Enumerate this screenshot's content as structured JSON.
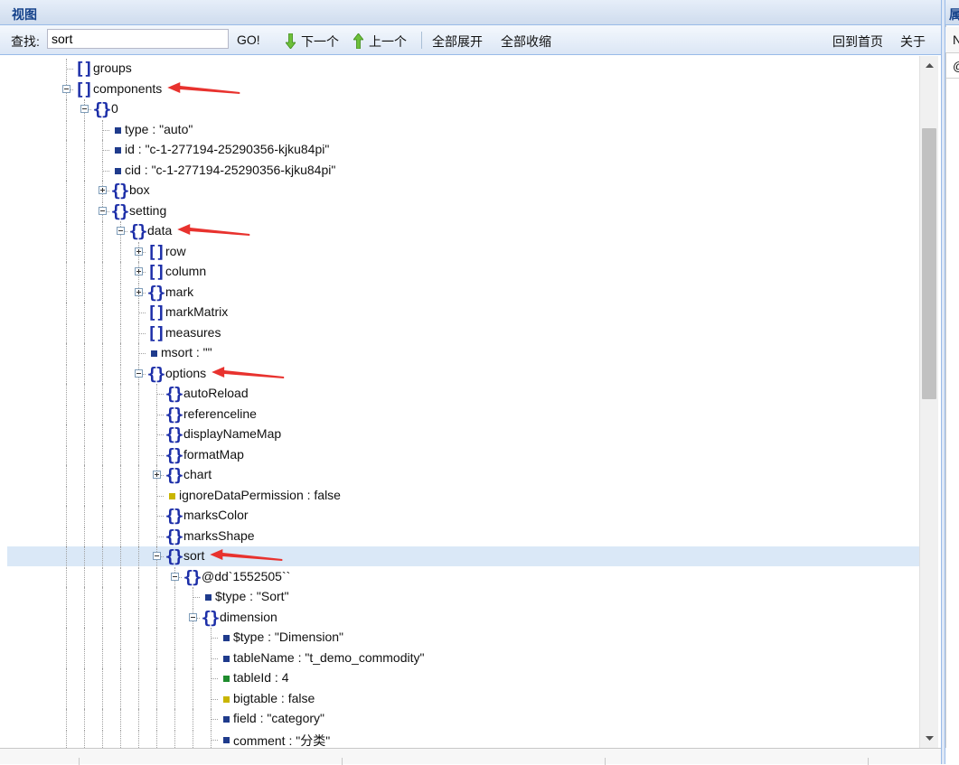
{
  "panel": {
    "title": "视图",
    "right_title": "属"
  },
  "right_panel": {
    "cell1": "N",
    "cell2": "@"
  },
  "toolbar": {
    "search_label": "查找:",
    "search_value": "sort",
    "go_label": "GO!",
    "next_label": "下一个",
    "prev_label": "上一个",
    "expand_all_label": "全部展开",
    "collapse_all_label": "全部收缩",
    "home_label": "回到首页",
    "about_label": "关于"
  },
  "colors": {
    "brace_icon": "#1c2ea8",
    "string_leaf": "#1f3b8c",
    "boolean_leaf": "#c9b500",
    "number_leaf": "#1f8c2e",
    "selected_row": "#dae8f7",
    "annotation_arrow": "#e8322e"
  },
  "tree": {
    "rows": [
      {
        "depth": 3,
        "kind": "array",
        "toggle": "none",
        "text": "groups"
      },
      {
        "depth": 3,
        "kind": "array",
        "toggle": "minus",
        "text": "components",
        "arrow": true
      },
      {
        "depth": 4,
        "kind": "object",
        "toggle": "minus",
        "text": "0"
      },
      {
        "depth": 5,
        "kind": "str",
        "toggle": "none",
        "text": "type : \"auto\""
      },
      {
        "depth": 5,
        "kind": "str",
        "toggle": "none",
        "text": "id : \"c-1-277194-25290356-kjku84pi\""
      },
      {
        "depth": 5,
        "kind": "str",
        "toggle": "none",
        "text": "cid : \"c-1-277194-25290356-kjku84pi\""
      },
      {
        "depth": 5,
        "kind": "object",
        "toggle": "plus",
        "text": "box"
      },
      {
        "depth": 5,
        "kind": "object",
        "toggle": "minus",
        "text": "setting"
      },
      {
        "depth": 6,
        "kind": "object",
        "toggle": "minus",
        "text": "data",
        "arrow": true
      },
      {
        "depth": 7,
        "kind": "array",
        "toggle": "plus",
        "text": "row"
      },
      {
        "depth": 7,
        "kind": "array",
        "toggle": "plus",
        "text": "column"
      },
      {
        "depth": 7,
        "kind": "object",
        "toggle": "plus",
        "text": "mark"
      },
      {
        "depth": 7,
        "kind": "array",
        "toggle": "none",
        "text": "markMatrix"
      },
      {
        "depth": 7,
        "kind": "array",
        "toggle": "none",
        "text": "measures"
      },
      {
        "depth": 7,
        "kind": "str",
        "toggle": "none",
        "text": "msort : \"\""
      },
      {
        "depth": 7,
        "kind": "object",
        "toggle": "minus",
        "text": "options",
        "arrow": true
      },
      {
        "depth": 8,
        "kind": "object",
        "toggle": "none",
        "text": "autoReload"
      },
      {
        "depth": 8,
        "kind": "object",
        "toggle": "none",
        "text": "referenceline"
      },
      {
        "depth": 8,
        "kind": "object",
        "toggle": "none",
        "text": "displayNameMap"
      },
      {
        "depth": 8,
        "kind": "object",
        "toggle": "none",
        "text": "formatMap"
      },
      {
        "depth": 8,
        "kind": "object",
        "toggle": "plus",
        "text": "chart"
      },
      {
        "depth": 8,
        "kind": "bool",
        "toggle": "none",
        "text": "ignoreDataPermission : false"
      },
      {
        "depth": 8,
        "kind": "object",
        "toggle": "none",
        "text": "marksColor"
      },
      {
        "depth": 8,
        "kind": "object",
        "toggle": "none",
        "text": "marksShape"
      },
      {
        "depth": 8,
        "kind": "object",
        "toggle": "minus",
        "text": "sort",
        "arrow": true,
        "selected": true
      },
      {
        "depth": 9,
        "kind": "object",
        "toggle": "minus",
        "text": "@dd`1552505``"
      },
      {
        "depth": 10,
        "kind": "str",
        "toggle": "none",
        "text": "$type : \"Sort\""
      },
      {
        "depth": 10,
        "kind": "object",
        "toggle": "minus",
        "text": "dimension"
      },
      {
        "depth": 11,
        "kind": "str",
        "toggle": "none",
        "text": "$type : \"Dimension\""
      },
      {
        "depth": 11,
        "kind": "str",
        "toggle": "none",
        "text": "tableName : \"t_demo_commodity\""
      },
      {
        "depth": 11,
        "kind": "num",
        "toggle": "none",
        "text": "tableId : 4"
      },
      {
        "depth": 11,
        "kind": "bool",
        "toggle": "none",
        "text": "bigtable : false"
      },
      {
        "depth": 11,
        "kind": "str",
        "toggle": "none",
        "text": "field : \"category\""
      },
      {
        "depth": 11,
        "kind": "str",
        "toggle": "none",
        "text": "comment : \"分类\""
      }
    ]
  }
}
